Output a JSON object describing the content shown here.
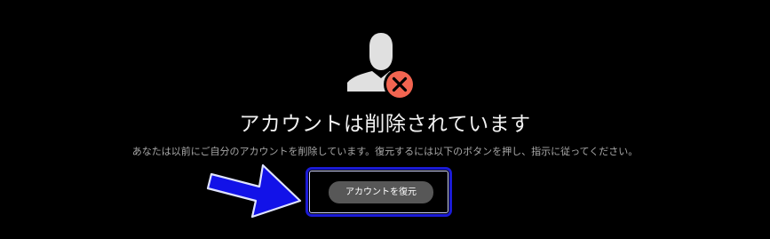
{
  "page": {
    "title": "アカウントは削除されています",
    "description": "あなたは以前にご自分のアカウントを削除しています。復元するには以下のボタンを押し、指示に従ってください。"
  },
  "actions": {
    "restore_label": "アカウントを復元"
  },
  "icons": {
    "user": "user-silhouette-icon",
    "deleted_badge": "close-circle-icon",
    "pointer": "arrow-right-icon"
  },
  "colors": {
    "background": "#000000",
    "badge": "#f26450",
    "highlight": "#1b1bd6",
    "button": "#575757"
  }
}
